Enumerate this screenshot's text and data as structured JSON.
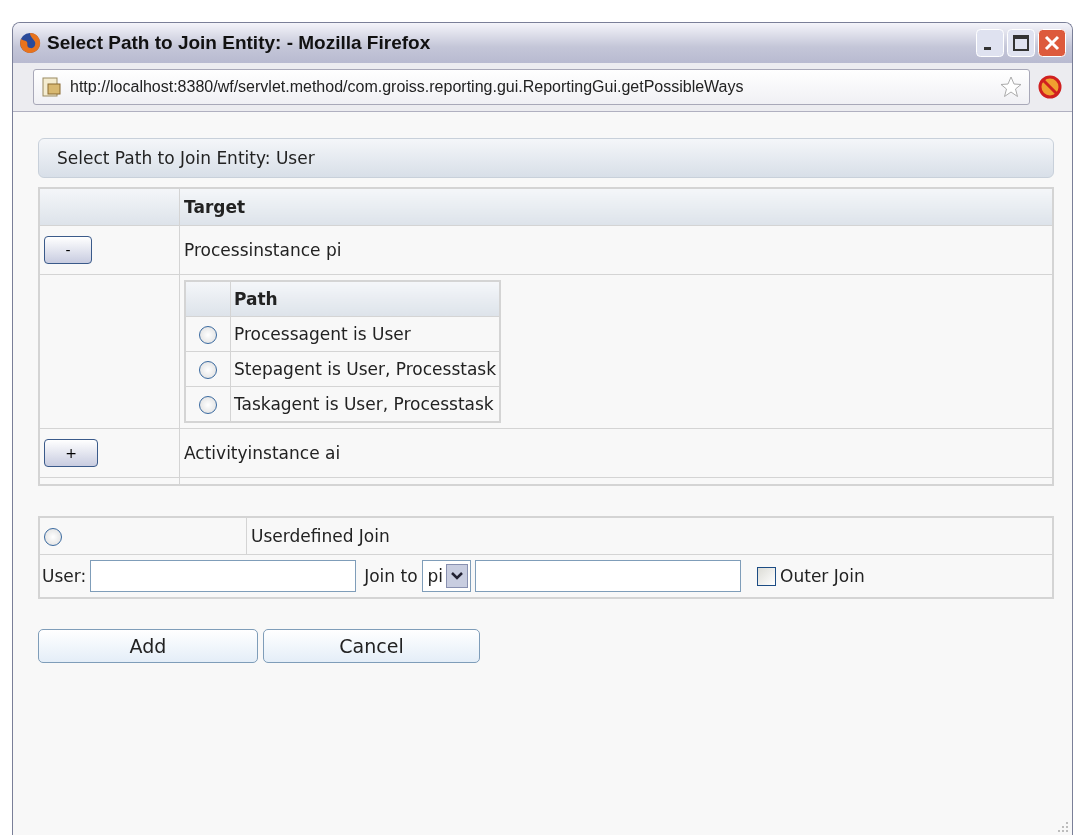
{
  "window": {
    "title": "Select Path to Join Entity: - Mozilla Firefox",
    "url": "http://localhost:8380/wf/servlet.method/com.groiss.reporting.gui.ReportingGui.getPossibleWays"
  },
  "panel_title": "Select Path to Join Entity: User",
  "table": {
    "columns": [
      "Target"
    ],
    "rows": [
      {
        "toggle": "-",
        "expanded": true,
        "target": "Processinstance pi",
        "paths": {
          "column": "Path",
          "rows": [
            {
              "label": "Processagent is User",
              "selected": false
            },
            {
              "label": "Stepagent is User, Processtask",
              "selected": false
            },
            {
              "label": "Taskagent is User, Processtask",
              "selected": false
            }
          ]
        }
      },
      {
        "toggle": "+",
        "expanded": false,
        "target": "Activityinstance ai"
      }
    ]
  },
  "userdefined": {
    "selected": false,
    "label": "Userdefined Join",
    "user_label": "User:",
    "join_label": "Join to",
    "join_select": "pi",
    "outer_join": {
      "label": "Outer Join",
      "checked": false
    }
  },
  "buttons": [
    "Add",
    "Cancel"
  ]
}
